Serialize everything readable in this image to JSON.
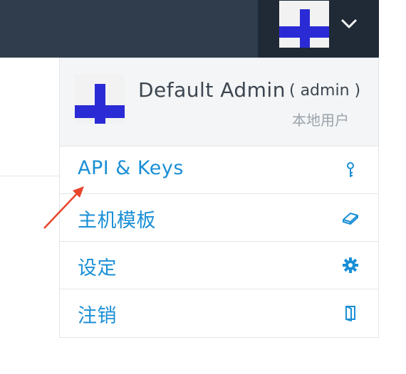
{
  "user": {
    "name": "Default Admin",
    "login": "( admin )",
    "type": "本地用户"
  },
  "menu": [
    {
      "label": "API & Keys",
      "icon": "key-icon"
    },
    {
      "label": "主机模板",
      "icon": "eraser-icon"
    },
    {
      "label": "设定",
      "icon": "gear-icon"
    },
    {
      "label": "注销",
      "icon": "door-icon"
    }
  ],
  "colors": {
    "topbar": "#2f3d4d",
    "toggle": "#1f2a36",
    "link": "#1a8fd6",
    "avatar": "#2b2bd6",
    "arrow": "#e8452c"
  }
}
